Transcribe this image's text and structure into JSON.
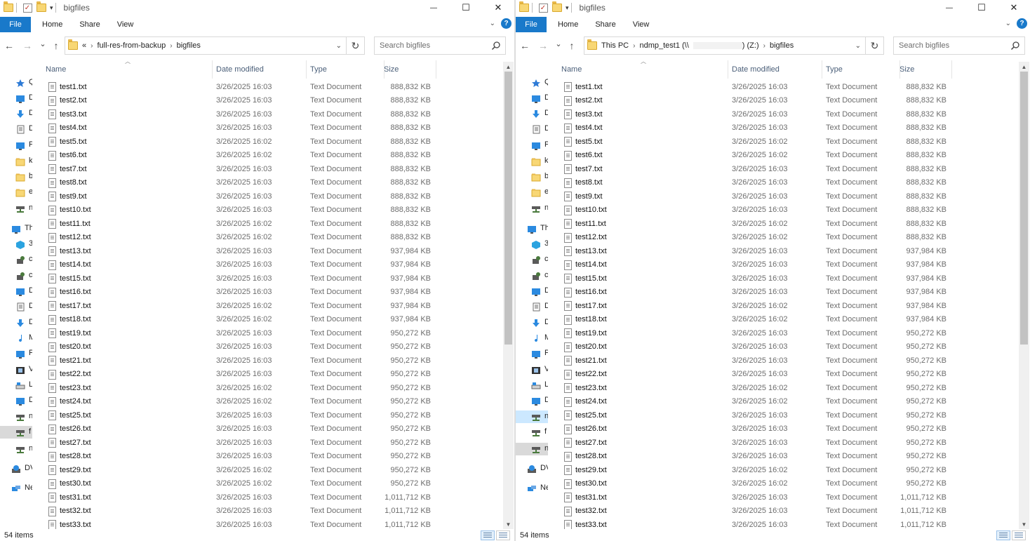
{
  "colors": {
    "accent": "#1979ca",
    "header_text": "#4c607a",
    "secondary_text": "#6d6d6d",
    "thumb": "#c2c2c2"
  },
  "icons": {
    "folder": "folder-icon",
    "properties": "properties-checkbox-icon",
    "search": "search-icon",
    "refresh": "refresh-icon",
    "file": "text-file-icon"
  },
  "windows": [
    {
      "title": "bigfiles",
      "ribbon": {
        "file": "File",
        "tabs": [
          "Home",
          "Share",
          "View"
        ],
        "help": "?"
      },
      "nav": {
        "back": "←",
        "forward": "→",
        "recent": "⌄",
        "up": "↑"
      },
      "breadcrumb": [
        {
          "label": "«"
        },
        {
          "label": "full-res-from-backup"
        },
        {
          "label": "bigfiles"
        }
      ],
      "search_placeholder": "Search bigfiles",
      "navpane": [
        {
          "label": "Qu",
          "icon": "star-icon",
          "color": "#2e7bd6"
        },
        {
          "label": "D",
          "icon": "desktop-icon",
          "color": "#2b8ae0"
        },
        {
          "label": "D",
          "icon": "downloads-icon",
          "color": "#2b8ae0"
        },
        {
          "label": "D",
          "icon": "documents-icon",
          "color": "#6d6d6d"
        },
        {
          "label": "P",
          "icon": "pictures-icon",
          "color": "#2b8ae0"
        },
        {
          "label": "k",
          "icon": "folder-icon",
          "color": "#f8d775"
        },
        {
          "label": "b",
          "icon": "folder-icon",
          "color": "#f8d775"
        },
        {
          "label": "e",
          "icon": "folder-icon",
          "color": "#f8d775"
        },
        {
          "label": "n",
          "icon": "network-drive-icon",
          "color": "#4a7a3d"
        },
        {
          "label": "Th",
          "icon": "this-pc-icon",
          "color": "#2b8ae0"
        },
        {
          "label": "3",
          "icon": "3d-objects-icon",
          "color": "#2ba3e0"
        },
        {
          "label": "c",
          "icon": "network-location-icon",
          "color": "#4a7a3d"
        },
        {
          "label": "c",
          "icon": "network-location-icon",
          "color": "#4a7a3d"
        },
        {
          "label": "D",
          "icon": "desktop-icon",
          "color": "#2b8ae0"
        },
        {
          "label": "D",
          "icon": "documents-icon",
          "color": "#6d6d6d"
        },
        {
          "label": "D",
          "icon": "downloads-icon",
          "color": "#2b8ae0"
        },
        {
          "label": "M",
          "icon": "music-icon",
          "color": "#2b8ae0"
        },
        {
          "label": "P",
          "icon": "pictures-icon",
          "color": "#2b8ae0"
        },
        {
          "label": "V",
          "icon": "videos-icon",
          "color": "#333"
        },
        {
          "label": "L",
          "icon": "local-disk-icon",
          "color": "#2b8ae0"
        },
        {
          "label": "D",
          "icon": "drive-icon",
          "color": "#2b8ae0"
        },
        {
          "label": "n",
          "icon": "network-drive-icon",
          "color": "#4a7a3d"
        },
        {
          "label": "f",
          "icon": "network-drive-icon",
          "color": "#4a7a3d",
          "state": "gray"
        },
        {
          "label": "n",
          "icon": "network-drive-icon",
          "color": "#4a7a3d"
        },
        {
          "label": "DV",
          "icon": "dvd-icon",
          "color": "#2b8ae0"
        },
        {
          "label": "Ne",
          "icon": "network-icon",
          "color": "#2b8ae0"
        }
      ],
      "columns": [
        "Name",
        "Date modified",
        "Type",
        "Size"
      ],
      "status": "54 items",
      "scroll_thumb": {
        "start": 0.0,
        "end": 0.61
      }
    },
    {
      "title": "bigfiles",
      "ribbon": {
        "file": "File",
        "tabs": [
          "Home",
          "Share",
          "View"
        ],
        "help": "?"
      },
      "nav": {
        "back": "←",
        "forward": "→",
        "recent": "⌄",
        "up": "↑"
      },
      "breadcrumb": [
        {
          "label": "This PC"
        },
        {
          "label": "ndmp_test1 (\\\\"
        },
        {
          "label": ") (Z:)",
          "joined": true
        },
        {
          "label": "bigfiles"
        }
      ],
      "search_placeholder": "Search bigfiles",
      "navpane": [
        {
          "label": "Qu",
          "icon": "star-icon",
          "color": "#2e7bd6"
        },
        {
          "label": "D",
          "icon": "desktop-icon",
          "color": "#2b8ae0"
        },
        {
          "label": "D",
          "icon": "downloads-icon",
          "color": "#2b8ae0"
        },
        {
          "label": "D",
          "icon": "documents-icon",
          "color": "#6d6d6d"
        },
        {
          "label": "P",
          "icon": "pictures-icon",
          "color": "#2b8ae0"
        },
        {
          "label": "k",
          "icon": "folder-icon",
          "color": "#f8d775"
        },
        {
          "label": "b",
          "icon": "folder-icon",
          "color": "#f8d775"
        },
        {
          "label": "e",
          "icon": "folder-icon",
          "color": "#f8d775"
        },
        {
          "label": "n",
          "icon": "network-drive-icon",
          "color": "#4a7a3d"
        },
        {
          "label": "Th",
          "icon": "this-pc-icon",
          "color": "#2b8ae0"
        },
        {
          "label": "3",
          "icon": "3d-objects-icon",
          "color": "#2ba3e0"
        },
        {
          "label": "c",
          "icon": "network-location-icon",
          "color": "#4a7a3d"
        },
        {
          "label": "c",
          "icon": "network-location-icon",
          "color": "#4a7a3d"
        },
        {
          "label": "D",
          "icon": "desktop-icon",
          "color": "#2b8ae0"
        },
        {
          "label": "D",
          "icon": "documents-icon",
          "color": "#6d6d6d"
        },
        {
          "label": "D",
          "icon": "downloads-icon",
          "color": "#2b8ae0"
        },
        {
          "label": "M",
          "icon": "music-icon",
          "color": "#2b8ae0"
        },
        {
          "label": "P",
          "icon": "pictures-icon",
          "color": "#2b8ae0"
        },
        {
          "label": "V",
          "icon": "videos-icon",
          "color": "#333"
        },
        {
          "label": "L",
          "icon": "local-disk-icon",
          "color": "#2b8ae0"
        },
        {
          "label": "D",
          "icon": "drive-icon",
          "color": "#2b8ae0"
        },
        {
          "label": "n",
          "icon": "network-drive-icon",
          "color": "#4a7a3d",
          "state": "selected"
        },
        {
          "label": "f",
          "icon": "network-drive-icon",
          "color": "#4a7a3d"
        },
        {
          "label": "n",
          "icon": "network-drive-icon",
          "color": "#4a7a3d",
          "state": "gray"
        },
        {
          "label": "DV",
          "icon": "dvd-icon",
          "color": "#2b8ae0"
        },
        {
          "label": "Ne",
          "icon": "network-icon",
          "color": "#2b8ae0"
        }
      ],
      "columns": [
        "Name",
        "Date modified",
        "Type",
        "Size"
      ],
      "status": "54 items",
      "scroll_thumb": {
        "start": 0.0,
        "end": 0.61
      }
    }
  ],
  "files": [
    {
      "name": "test1.txt",
      "date": "3/26/2025 16:03",
      "type": "Text Document",
      "size": "888,832 KB"
    },
    {
      "name": "test2.txt",
      "date": "3/26/2025 16:03",
      "type": "Text Document",
      "size": "888,832 KB"
    },
    {
      "name": "test3.txt",
      "date": "3/26/2025 16:03",
      "type": "Text Document",
      "size": "888,832 KB"
    },
    {
      "name": "test4.txt",
      "date": "3/26/2025 16:03",
      "type": "Text Document",
      "size": "888,832 KB"
    },
    {
      "name": "test5.txt",
      "date": "3/26/2025 16:02",
      "type": "Text Document",
      "size": "888,832 KB"
    },
    {
      "name": "test6.txt",
      "date": "3/26/2025 16:02",
      "type": "Text Document",
      "size": "888,832 KB"
    },
    {
      "name": "test7.txt",
      "date": "3/26/2025 16:03",
      "type": "Text Document",
      "size": "888,832 KB"
    },
    {
      "name": "test8.txt",
      "date": "3/26/2025 16:03",
      "type": "Text Document",
      "size": "888,832 KB"
    },
    {
      "name": "test9.txt",
      "date": "3/26/2025 16:03",
      "type": "Text Document",
      "size": "888,832 KB"
    },
    {
      "name": "test10.txt",
      "date": "3/26/2025 16:03",
      "type": "Text Document",
      "size": "888,832 KB"
    },
    {
      "name": "test11.txt",
      "date": "3/26/2025 16:02",
      "type": "Text Document",
      "size": "888,832 KB"
    },
    {
      "name": "test12.txt",
      "date": "3/26/2025 16:02",
      "type": "Text Document",
      "size": "888,832 KB"
    },
    {
      "name": "test13.txt",
      "date": "3/26/2025 16:03",
      "type": "Text Document",
      "size": "937,984 KB"
    },
    {
      "name": "test14.txt",
      "date": "3/26/2025 16:03",
      "type": "Text Document",
      "size": "937,984 KB"
    },
    {
      "name": "test15.txt",
      "date": "3/26/2025 16:03",
      "type": "Text Document",
      "size": "937,984 KB"
    },
    {
      "name": "test16.txt",
      "date": "3/26/2025 16:03",
      "type": "Text Document",
      "size": "937,984 KB"
    },
    {
      "name": "test17.txt",
      "date": "3/26/2025 16:02",
      "type": "Text Document",
      "size": "937,984 KB"
    },
    {
      "name": "test18.txt",
      "date": "3/26/2025 16:02",
      "type": "Text Document",
      "size": "937,984 KB"
    },
    {
      "name": "test19.txt",
      "date": "3/26/2025 16:03",
      "type": "Text Document",
      "size": "950,272 KB"
    },
    {
      "name": "test20.txt",
      "date": "3/26/2025 16:03",
      "type": "Text Document",
      "size": "950,272 KB"
    },
    {
      "name": "test21.txt",
      "date": "3/26/2025 16:03",
      "type": "Text Document",
      "size": "950,272 KB"
    },
    {
      "name": "test22.txt",
      "date": "3/26/2025 16:03",
      "type": "Text Document",
      "size": "950,272 KB"
    },
    {
      "name": "test23.txt",
      "date": "3/26/2025 16:02",
      "type": "Text Document",
      "size": "950,272 KB"
    },
    {
      "name": "test24.txt",
      "date": "3/26/2025 16:02",
      "type": "Text Document",
      "size": "950,272 KB"
    },
    {
      "name": "test25.txt",
      "date": "3/26/2025 16:03",
      "type": "Text Document",
      "size": "950,272 KB"
    },
    {
      "name": "test26.txt",
      "date": "3/26/2025 16:03",
      "type": "Text Document",
      "size": "950,272 KB"
    },
    {
      "name": "test27.txt",
      "date": "3/26/2025 16:03",
      "type": "Text Document",
      "size": "950,272 KB"
    },
    {
      "name": "test28.txt",
      "date": "3/26/2025 16:03",
      "type": "Text Document",
      "size": "950,272 KB"
    },
    {
      "name": "test29.txt",
      "date": "3/26/2025 16:02",
      "type": "Text Document",
      "size": "950,272 KB"
    },
    {
      "name": "test30.txt",
      "date": "3/26/2025 16:02",
      "type": "Text Document",
      "size": "950,272 KB"
    },
    {
      "name": "test31.txt",
      "date": "3/26/2025 16:03",
      "type": "Text Document",
      "size": "1,011,712 KB"
    },
    {
      "name": "test32.txt",
      "date": "3/26/2025 16:03",
      "type": "Text Document",
      "size": "1,011,712 KB"
    },
    {
      "name": "test33.txt",
      "date": "3/26/2025 16:03",
      "type": "Text Document",
      "size": "1,011,712 KB"
    }
  ]
}
